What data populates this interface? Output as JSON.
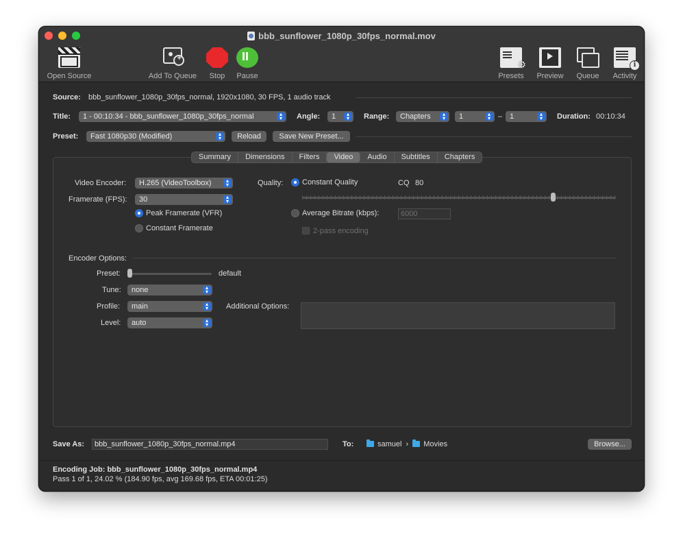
{
  "window": {
    "title": "bbb_sunflower_1080p_30fps_normal.mov"
  },
  "toolbar": {
    "open_source": "Open Source",
    "add_to_queue": "Add To Queue",
    "stop": "Stop",
    "pause": "Pause",
    "presets": "Presets",
    "preview": "Preview",
    "queue": "Queue",
    "activity": "Activity"
  },
  "source": {
    "label": "Source:",
    "value": "bbb_sunflower_1080p_30fps_normal, 1920x1080, 30 FPS, 1 audio track"
  },
  "title_row": {
    "title_label": "Title:",
    "title_value": "1 - 00:10:34 - bbb_sunflower_1080p_30fps_normal",
    "angle_label": "Angle:",
    "angle_value": "1",
    "range_label": "Range:",
    "range_value": "Chapters",
    "range_start": "1",
    "range_dash": "–",
    "range_end": "1",
    "duration_label": "Duration:",
    "duration_value": "00:10:34"
  },
  "preset_row": {
    "label": "Preset:",
    "value": "Fast 1080p30 (Modified)",
    "reload": "Reload",
    "save_new": "Save New Preset..."
  },
  "tabs": [
    "Summary",
    "Dimensions",
    "Filters",
    "Video",
    "Audio",
    "Subtitles",
    "Chapters"
  ],
  "active_tab": "Video",
  "video": {
    "encoder_label": "Video Encoder:",
    "encoder_value": "H.265 (VideoToolbox)",
    "framerate_label": "Framerate (FPS):",
    "framerate_value": "30",
    "peak_framerate": "Peak Framerate (VFR)",
    "constant_framerate": "Constant Framerate",
    "quality_label": "Quality:",
    "constant_quality": "Constant Quality",
    "cq_label": "CQ",
    "cq_value": "80",
    "cq_slider_level": 0.8,
    "avg_bitrate": "Average Bitrate (kbps):",
    "avg_bitrate_value": "6000",
    "two_pass": "2-pass encoding"
  },
  "encoder_options": {
    "heading": "Encoder Options:",
    "preset_label": "Preset:",
    "preset_value": "default",
    "tune_label": "Tune:",
    "tune_value": "none",
    "profile_label": "Profile:",
    "profile_value": "main",
    "level_label": "Level:",
    "level_value": "auto",
    "additional_label": "Additional Options:"
  },
  "save": {
    "label": "Save As:",
    "filename": "bbb_sunflower_1080p_30fps_normal.mp4",
    "to_label": "To:",
    "path_user": "samuel",
    "path_sep": "›",
    "path_folder": "Movies",
    "browse": "Browse..."
  },
  "status": {
    "job": "Encoding Job: bbb_sunflower_1080p_30fps_normal.mp4",
    "progress": "Pass 1 of 1, 24.02 % (184.90 fps, avg 169.68 fps, ETA 00:01:25)"
  },
  "colors": {
    "accent": "#2d6fd6",
    "stop": "#e8282b",
    "pause": "#4fbf3a",
    "folder": "#3ea8e8"
  }
}
